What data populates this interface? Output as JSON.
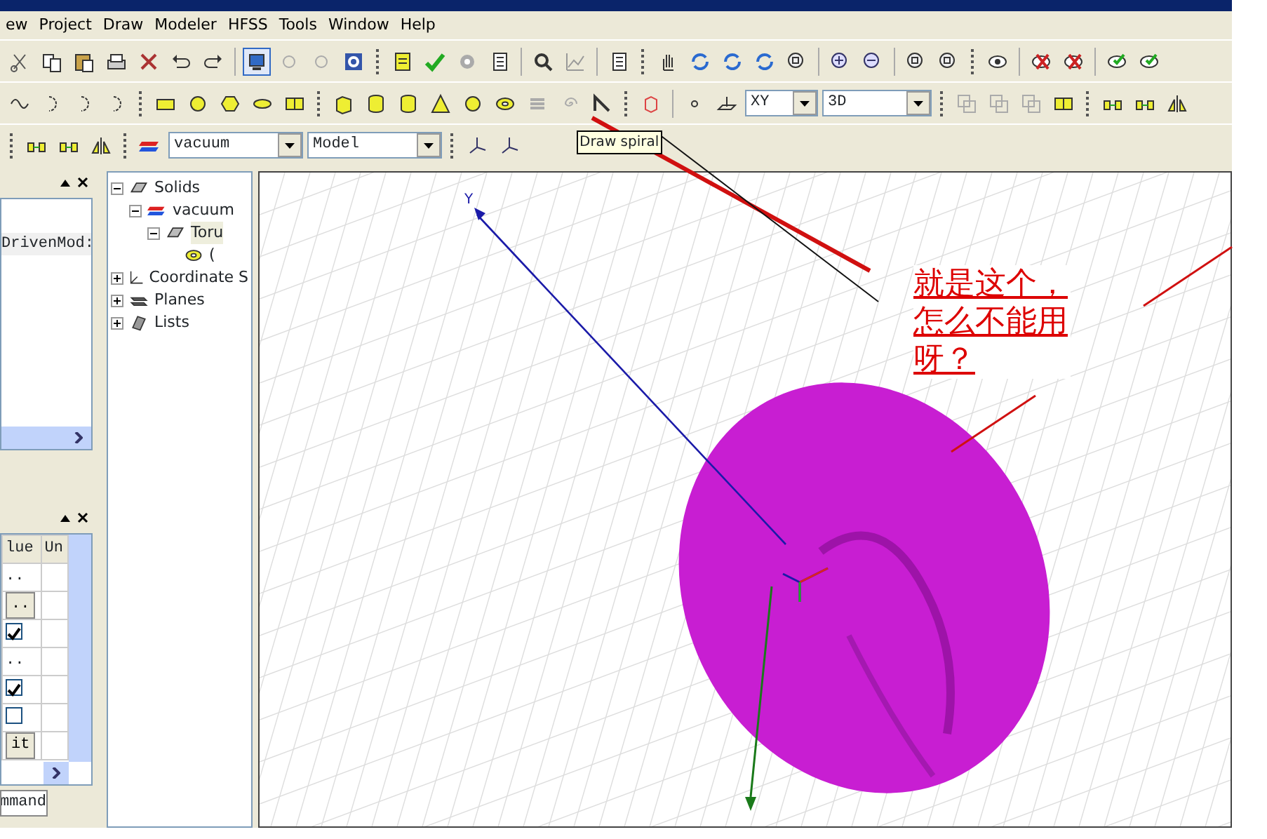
{
  "menu": [
    {
      "label": "ew"
    },
    {
      "label": "Project"
    },
    {
      "label": "Draw"
    },
    {
      "label": "Modeler"
    },
    {
      "label": "HFSS"
    },
    {
      "label": "Tools"
    },
    {
      "label": "Window"
    },
    {
      "label": "Help"
    }
  ],
  "toolbar_2": {
    "plane_combo": "XY",
    "mode_combo": "3D"
  },
  "toolbar_3": {
    "material_combo": "vacuum",
    "view_combo": "Model"
  },
  "tooltip": "Draw spiral",
  "project_panel": {
    "row_text": "DrivenMod:"
  },
  "properties_panel": {
    "columns": [
      "lue",
      "Un"
    ],
    "rows": [
      {
        "kind": "text",
        "value": ".."
      },
      {
        "kind": "button",
        "value": ".."
      },
      {
        "kind": "check",
        "checked": true
      },
      {
        "kind": "text",
        "value": ".."
      },
      {
        "kind": "check",
        "checked": true
      },
      {
        "kind": "check",
        "checked": false
      },
      {
        "kind": "button",
        "value": "it"
      }
    ],
    "tab": "mmand"
  },
  "tree": [
    {
      "label": "Solids",
      "kind": "solid",
      "expanded": true,
      "children": [
        {
          "label": "vacuum",
          "kind": "material",
          "expanded": true,
          "children": [
            {
              "label": "Toru",
              "kind": "solid",
              "expanded": true,
              "selected": true,
              "children": [
                {
                  "label": "(",
                  "kind": "ring",
                  "selected": false
                }
              ]
            }
          ]
        }
      ]
    },
    {
      "label": "Coordinate S",
      "kind": "axes",
      "expanded": false
    },
    {
      "label": "Planes",
      "kind": "planes",
      "expanded": false
    },
    {
      "label": "Lists",
      "kind": "list",
      "expanded": false
    }
  ],
  "viewport": {
    "axis_label": "Y"
  },
  "annotation": "就是这个，怎么不能用呀？"
}
